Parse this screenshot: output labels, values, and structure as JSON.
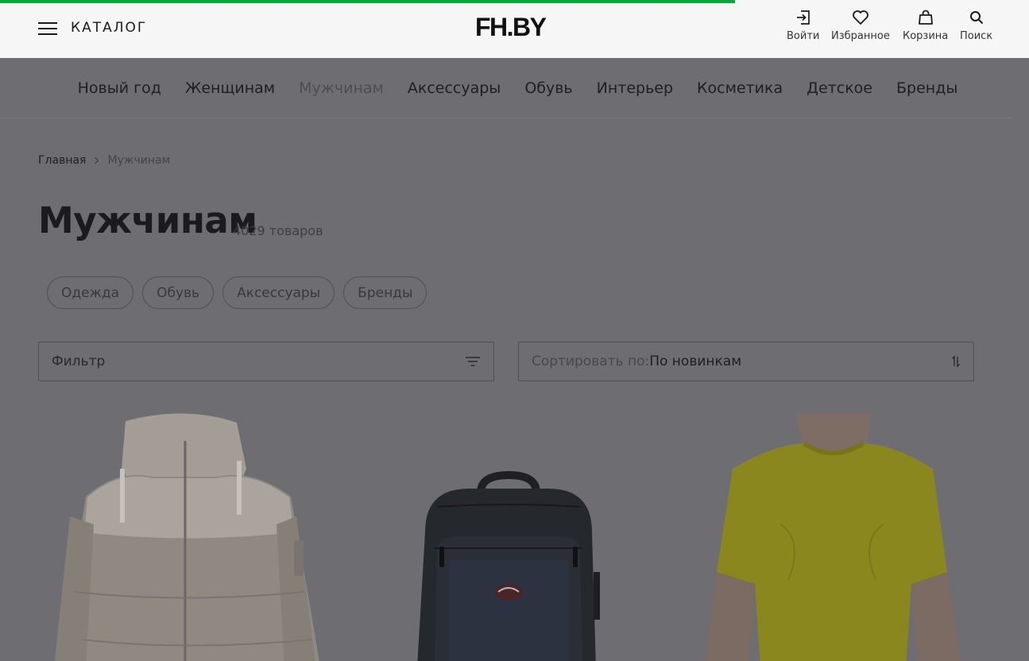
{
  "progress_fraction": 0.714,
  "header": {
    "catalog_label": "КАТАЛОГ",
    "logo": "FH.BY",
    "actions": [
      {
        "label": "Войти",
        "icon": "login-icon"
      },
      {
        "label": "Избранное",
        "icon": "heart-icon"
      },
      {
        "label": "Корзина",
        "icon": "bag-icon"
      },
      {
        "label": "Поиск",
        "icon": "search-icon"
      }
    ]
  },
  "nav": {
    "items": [
      {
        "label": "Новый год"
      },
      {
        "label": "Женщинам"
      },
      {
        "label": "Мужчинам",
        "active": true
      },
      {
        "label": "Аксессуары"
      },
      {
        "label": "Обувь"
      },
      {
        "label": "Интерьер"
      },
      {
        "label": "Косметика"
      },
      {
        "label": "Детское"
      },
      {
        "label": "Бренды"
      }
    ]
  },
  "breadcrumb": {
    "home": "Главная",
    "current": "Мужчинам"
  },
  "page": {
    "title": "Мужчинам",
    "count": "4029 товаров"
  },
  "chips": [
    {
      "label": "Одежда"
    },
    {
      "label": "Обувь"
    },
    {
      "label": "Аксессуары"
    },
    {
      "label": "Бренды"
    }
  ],
  "filter": {
    "label": "Фильтр",
    "icon": "filter-icon"
  },
  "sort": {
    "prefix": "Сортировать по:",
    "value": "По новинкам",
    "icon": "sort-arrows-icon"
  },
  "products": [
    {
      "image": "puffer-jacket",
      "color": "#9c958e"
    },
    {
      "image": "backpack",
      "color": "#25282d"
    },
    {
      "image": "t-shirt",
      "color": "#8a871e"
    }
  ],
  "colors": {
    "accent": "#0aa83a",
    "overlay": "#6e6e72",
    "header_bg": "#f6f6f6"
  }
}
